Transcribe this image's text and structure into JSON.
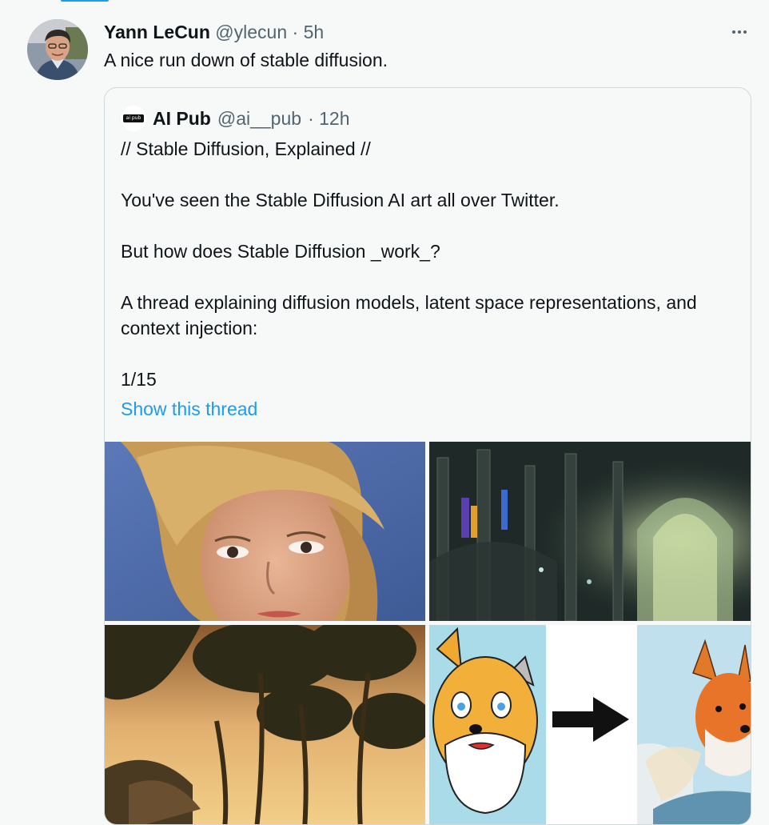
{
  "tweet": {
    "author_name": "Yann LeCun",
    "author_handle": "@ylecun",
    "time": "· 5h",
    "text": "A nice run down of stable diffusion."
  },
  "quoted": {
    "author_name": "AI Pub",
    "author_handle": "@ai__pub",
    "time": "· 12h",
    "lines": [
      "// Stable Diffusion, Explained //",
      "You've seen the Stable Diffusion AI art all over Twitter.",
      "But how does Stable Diffusion _work_?",
      "A thread explaining diffusion models, latent space representations, and context injection:",
      "1/15"
    ],
    "show_thread": "Show this thread"
  },
  "colors": {
    "link": "#1d9bf0",
    "muted": "#536471",
    "border": "#cfd9de"
  }
}
